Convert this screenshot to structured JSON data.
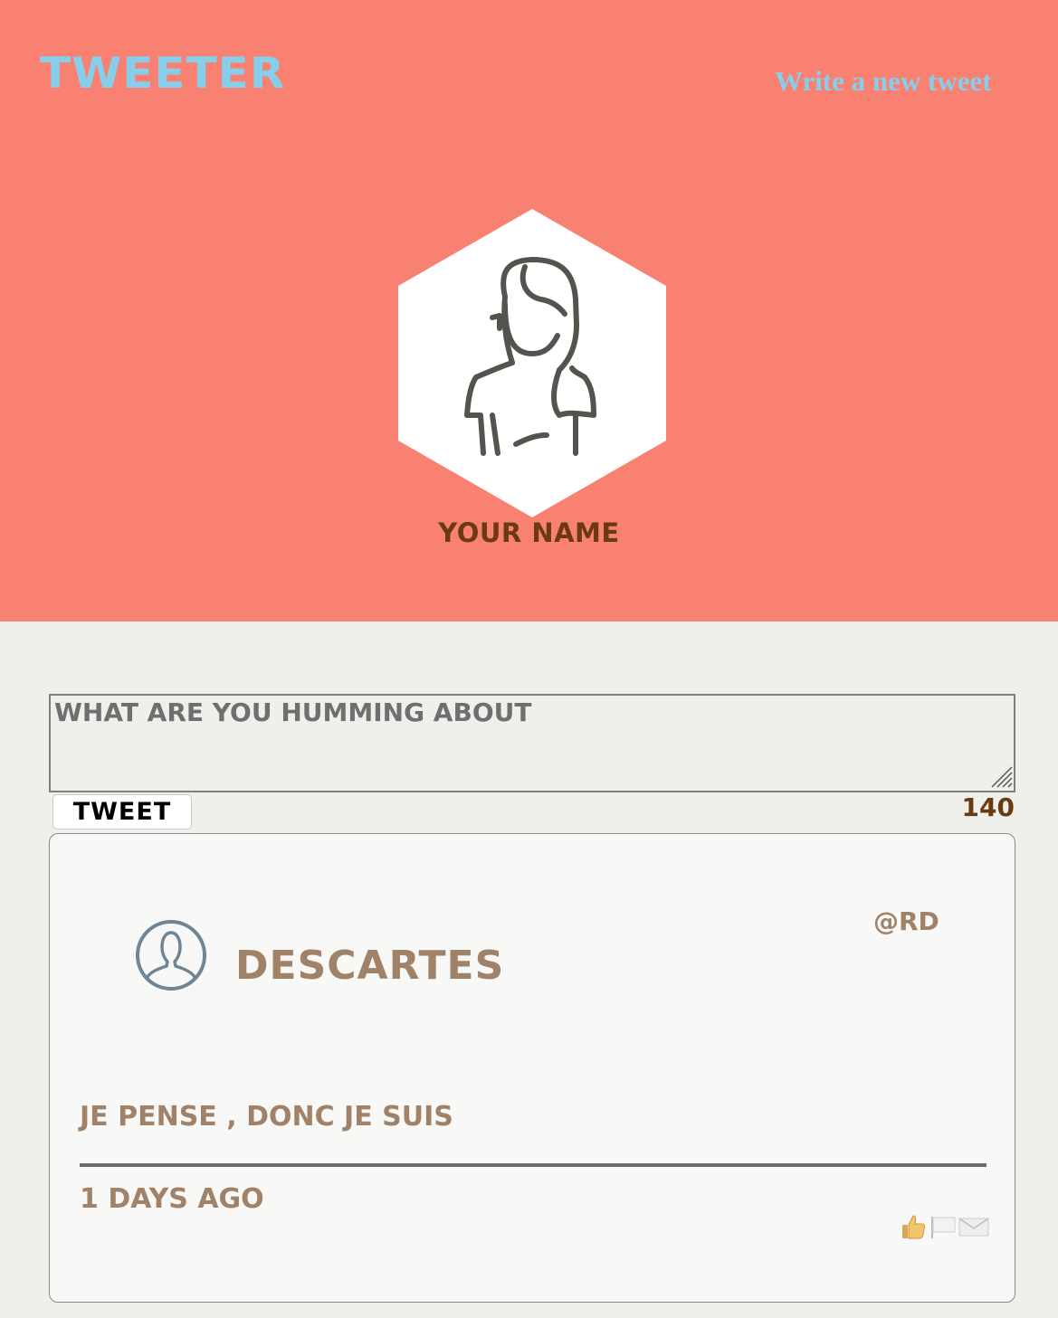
{
  "header": {
    "brand": "Tweeter",
    "compose_link": "Write a new tweet",
    "profile_name": "Your Name",
    "colors": {
      "background": "#f98172",
      "brand": "#87ceeb",
      "name": "#6b3a10"
    }
  },
  "composer": {
    "placeholder": "What are you humming about",
    "value": "",
    "submit_label": "Tweet",
    "char_counter": "140"
  },
  "tweets": [
    {
      "author_name": "Descartes",
      "handle": "@rd",
      "text": "Je pense , donc je suis",
      "timestamp": "1 days ago",
      "avatar_icon": "user-outline-icon",
      "actions": [
        "like-icon",
        "flag-icon",
        "envelope-icon"
      ]
    }
  ]
}
